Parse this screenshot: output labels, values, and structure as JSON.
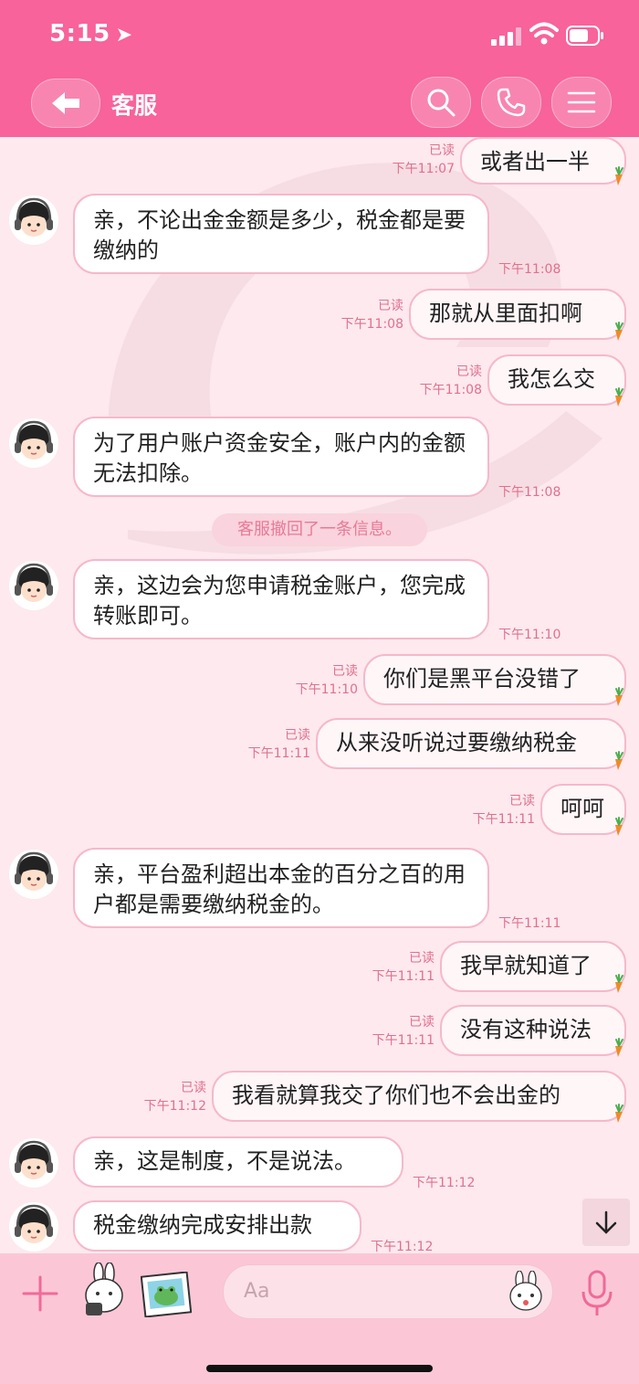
{
  "status_bar": {
    "time": "5:15"
  },
  "header": {
    "title": "客服"
  },
  "read_label": "已读",
  "messages": [
    {
      "dir": "out",
      "text": "或者出一半",
      "time": "下午11:07",
      "read": true
    },
    {
      "dir": "in",
      "text": "亲，不论出金金额是多少，税金都是要缴纳的",
      "time": "下午11:08"
    },
    {
      "dir": "out",
      "text": "那就从里面扣啊",
      "time": "下午11:08",
      "read": true
    },
    {
      "dir": "out",
      "text": "我怎么交",
      "time": "下午11:08",
      "read": true
    },
    {
      "dir": "in",
      "text": "为了用户账户资金安全，账户内的金额无法扣除。",
      "time": "下午11:08"
    },
    {
      "dir": "system",
      "text": "客服撤回了一条信息。"
    },
    {
      "dir": "in",
      "text": "亲，这边会为您申请税金账户，您完成转账即可。",
      "time": "下午11:10"
    },
    {
      "dir": "out",
      "text": "你们是黑平台没错了",
      "time": "下午11:10",
      "read": true
    },
    {
      "dir": "out",
      "text": "从来没听说过要缴纳税金",
      "time": "下午11:11",
      "read": true
    },
    {
      "dir": "out",
      "text": "呵呵",
      "time": "下午11:11",
      "read": true
    },
    {
      "dir": "in",
      "text": "亲，平台盈利超出本金的百分之百的用户都是需要缴纳税金的。",
      "time": "下午11:11"
    },
    {
      "dir": "out",
      "text": "我早就知道了",
      "time": "下午11:11",
      "read": true
    },
    {
      "dir": "out",
      "text": "没有这种说法",
      "time": "下午11:11",
      "read": true
    },
    {
      "dir": "out",
      "text": "我看就算我交了你们也不会出金的",
      "time": "下午11:12",
      "read": true
    },
    {
      "dir": "in",
      "text": "亲，这是制度，不是说法。",
      "time": "下午11:12"
    },
    {
      "dir": "in",
      "text": "税金缴纳完成安排出款",
      "time": "下午11:12"
    }
  ],
  "input": {
    "placeholder": "Aa"
  },
  "icons": {
    "back": "arrow-left-icon",
    "search": "search-icon",
    "call": "phone-icon",
    "menu": "hamburger-menu-icon",
    "plus": "plus-icon",
    "sticker": "bunny-sticker-icon",
    "photo": "frog-photo-icon",
    "emoji": "bunny-emoji-icon",
    "mic": "microphone-icon",
    "scroll": "arrow-down-icon",
    "read_mark": "carrot-icon"
  },
  "colors": {
    "accent": "#f7639a",
    "background": "#fde9ee",
    "timestamp": "#e0708f",
    "bubble_border": "#f6b8ca"
  }
}
